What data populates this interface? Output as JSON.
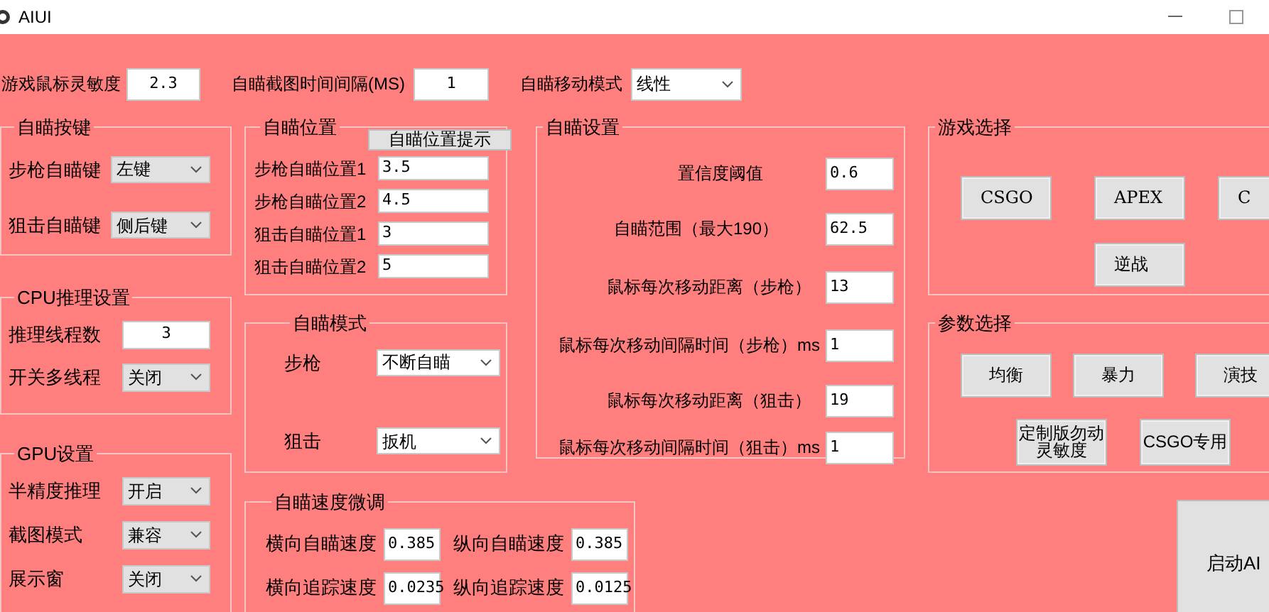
{
  "window": {
    "title": "AIUI"
  },
  "top": [
    {
      "label": "游戏鼠标灵敏度",
      "kind": "text",
      "value": "2.3"
    },
    {
      "label": "自瞄截图时间间隔(MS)",
      "kind": "text",
      "value": "1"
    },
    {
      "label": "自瞄移动模式",
      "kind": "dropdown",
      "value": "线性"
    }
  ],
  "aim_keys": {
    "title": "自瞄按键",
    "rows": [
      {
        "label": "步枪自瞄键",
        "kind": "dropdown",
        "value": "左键"
      },
      {
        "label": "狙击自瞄键",
        "kind": "dropdown",
        "value": "侧后键"
      }
    ]
  },
  "cpu": {
    "title": "CPU推理设置",
    "rows": [
      {
        "label": "推理线程数",
        "kind": "text",
        "value": "3"
      },
      {
        "label": "开关多线程",
        "kind": "dropdown",
        "value": "关闭"
      }
    ]
  },
  "gpu": {
    "title": "GPU设置",
    "rows": [
      {
        "label": "半精度推理",
        "kind": "dropdown",
        "value": "开启"
      },
      {
        "label": "截图模式",
        "kind": "dropdown",
        "value": "兼容"
      },
      {
        "label": "展示窗",
        "kind": "dropdown",
        "value": "关闭"
      }
    ]
  },
  "aim_position": {
    "title": "自瞄位置",
    "hint_button": "自瞄位置提示",
    "rows": [
      {
        "label": "步枪自瞄位置1",
        "value": "3.5"
      },
      {
        "label": "步枪自瞄位置2",
        "value": "4.5"
      },
      {
        "label": "狙击自瞄位置1",
        "value": "3"
      },
      {
        "label": "狙击自瞄位置2",
        "value": "5"
      }
    ]
  },
  "aim_mode": {
    "title": "自瞄模式",
    "rows": [
      {
        "label": "步枪",
        "value": "不断自瞄"
      },
      {
        "label": "狙击",
        "value": "扳机"
      }
    ]
  },
  "speed_tuning": {
    "title": "自瞄速度微调",
    "rows": [
      {
        "label": "横向自瞄速度",
        "value": "0.385"
      },
      {
        "label": "纵向自瞄速度",
        "value": "0.385"
      },
      {
        "label": "横向追踪速度",
        "value": "0.0235"
      },
      {
        "label": "纵向追踪速度",
        "value": "0.0125"
      }
    ]
  },
  "aim_settings": {
    "title": "自瞄设置",
    "rows": [
      {
        "label": "置信度阈值",
        "value": "0.6"
      },
      {
        "label": "自瞄范围（最大190）",
        "value": "62.5"
      },
      {
        "label": "鼠标每次移动距离（步枪）",
        "value": "13"
      },
      {
        "label": "鼠标每次移动间隔时间（步枪）ms",
        "value": "1"
      },
      {
        "label": "鼠标每次移动距离（狙击）",
        "value": "19"
      },
      {
        "label": "鼠标每次移动间隔时间（狙击）ms",
        "value": "1"
      }
    ]
  },
  "game_select": {
    "title": "游戏选择",
    "buttons": [
      "CSGO",
      "APEX",
      "C",
      "逆战"
    ]
  },
  "preset_select": {
    "title": "参数选择",
    "buttons": [
      "均衡",
      "暴力",
      "演技",
      "定制版勿动灵敏度",
      "CSGO专用"
    ]
  },
  "start_button": "启动AI"
}
